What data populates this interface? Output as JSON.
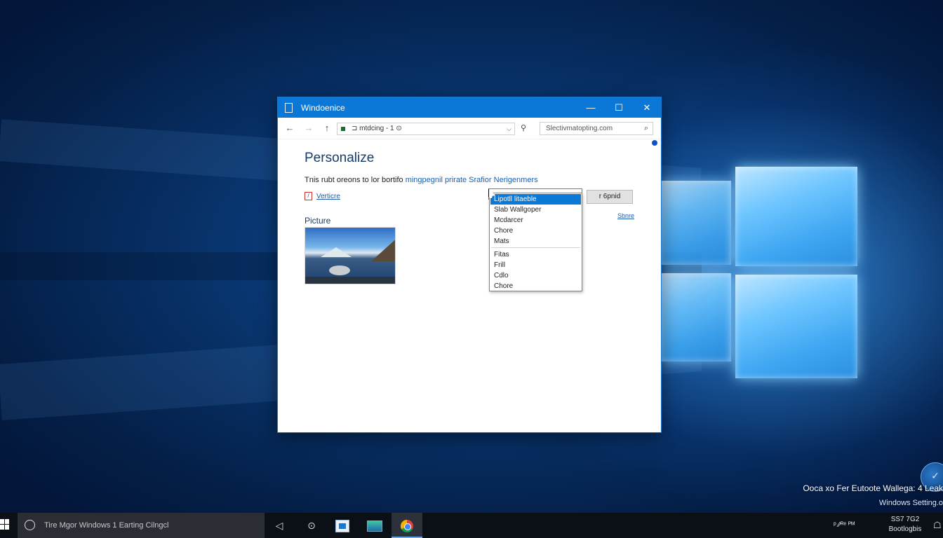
{
  "desktop": {
    "caption_line1": "Ooca xo Fer Eutoote Wallega: 4 Leak",
    "caption_line2": "Windows Setting.o"
  },
  "window": {
    "title": "Windoenice",
    "controls": {
      "minimize": "—",
      "maximize": "☐",
      "close": "✕"
    }
  },
  "navbar": {
    "address": "⊐ mtdcing -  1  ⊙",
    "search_placeholder": "Slectivmatopting.com"
  },
  "content": {
    "page_title": "Personalize",
    "description_plain": "Tnis rubt oreons to lor bortifo ",
    "description_link": "mingpegnil prirate Srafior Nerigenmers",
    "background_link": "Verticre",
    "picture_label": "Picture",
    "fit_button": "r 6pnid",
    "small_link": "Sbnre"
  },
  "dropdown": {
    "items": [
      {
        "label": "Lipotll litaeble",
        "selected": true
      },
      {
        "label": "Slab Wallgoper",
        "selected": false
      },
      {
        "label": "Mcdarcer",
        "selected": false
      },
      {
        "label": "Chore",
        "selected": false
      },
      {
        "label": "Mats",
        "selected": false
      }
    ],
    "items_after_separator": [
      {
        "label": "Fitas"
      },
      {
        "label": "Frill"
      },
      {
        "label": "Cdlo"
      },
      {
        "label": "Chore"
      }
    ]
  },
  "taskbar": {
    "search_text": "Tire Mgor Windows 1 Earting Cilngcl",
    "clock_time": "SS7 7G2",
    "clock_date": "Bootlogbis",
    "tray_text": "ᵖ ⁄⁄ᴿᵉ  ᴾᴹ"
  },
  "colors": {
    "accent": "#0b78d7",
    "title_text": "#153d6a",
    "link": "#1a5aa8",
    "selection": "#0a78d7"
  },
  "icons": [
    "app-icon",
    "back-arrow-icon",
    "forward-arrow-icon",
    "up-arrow-icon",
    "pin-icon",
    "search-icon",
    "start-icon",
    "task-view-icon",
    "cortana-icon",
    "store-icon",
    "monitor-app-icon",
    "chrome-icon"
  ]
}
